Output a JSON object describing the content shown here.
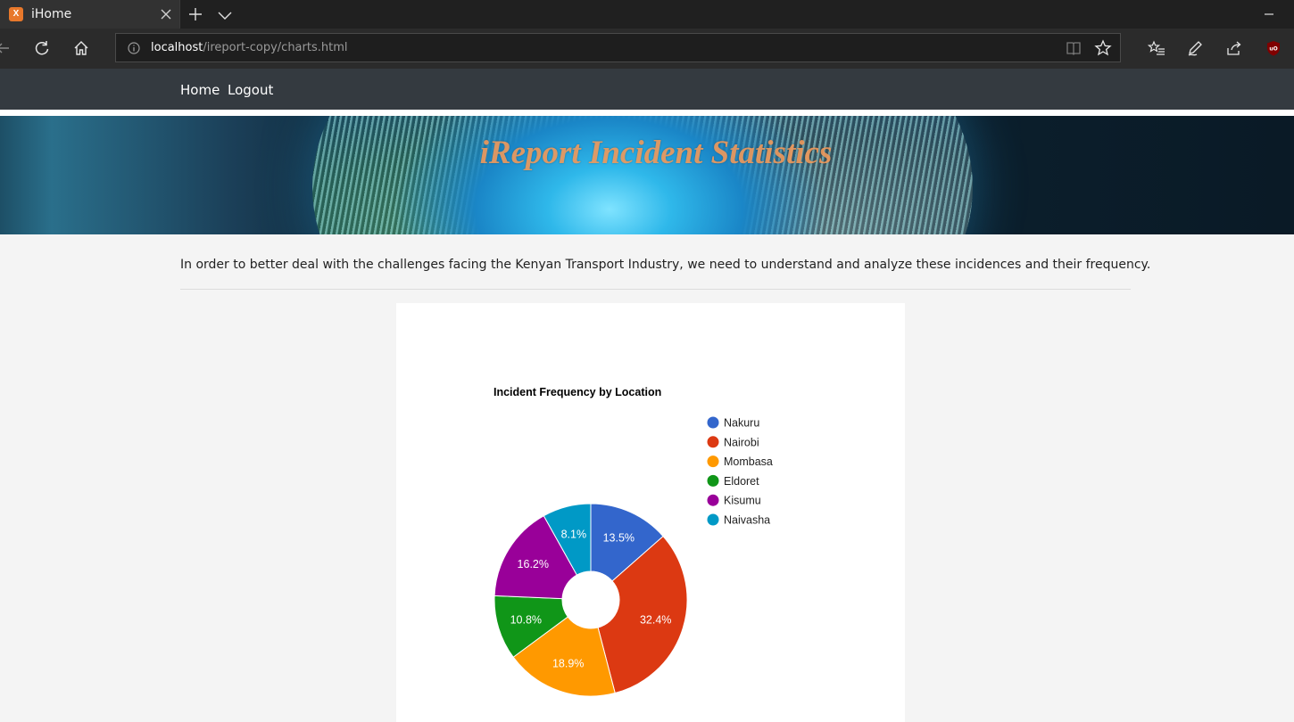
{
  "browser": {
    "tab_title": "iHome",
    "tab_favicon": "X",
    "url_host": "localhost",
    "url_path": "/ireport-copy/charts.html",
    "icons": [
      "close-icon",
      "plus-icon",
      "chevron-down-icon",
      "minimize-icon",
      "back-icon",
      "refresh-icon",
      "home-icon",
      "info-icon",
      "reading-view-icon",
      "star-icon",
      "favorites-icon",
      "pen-icon",
      "share-icon",
      "ublock-icon"
    ]
  },
  "nav": {
    "home": "Home",
    "logout": "Logout"
  },
  "banner": {
    "title": "iReport Incident Statistics"
  },
  "intro": "In order to better deal with the challenges facing the Kenyan Transport Industry, we need to understand and analyze these incidences and their frequency.",
  "chart_data": {
    "type": "pie",
    "donut": true,
    "title": "Incident Frequency by Location",
    "legend_position": "right",
    "categories": [
      "Nakuru",
      "Nairobi",
      "Mombasa",
      "Eldoret",
      "Kisumu",
      "Naivasha"
    ],
    "values": [
      13.5,
      32.4,
      18.9,
      10.8,
      16.2,
      8.1
    ],
    "labels": [
      "13.5%",
      "32.4%",
      "18.9%",
      "10.8%",
      "16.2%",
      "8.1%"
    ],
    "colors": [
      "#3366cc",
      "#dc3912",
      "#ff9900",
      "#109618",
      "#990099",
      "#0099c6"
    ]
  }
}
